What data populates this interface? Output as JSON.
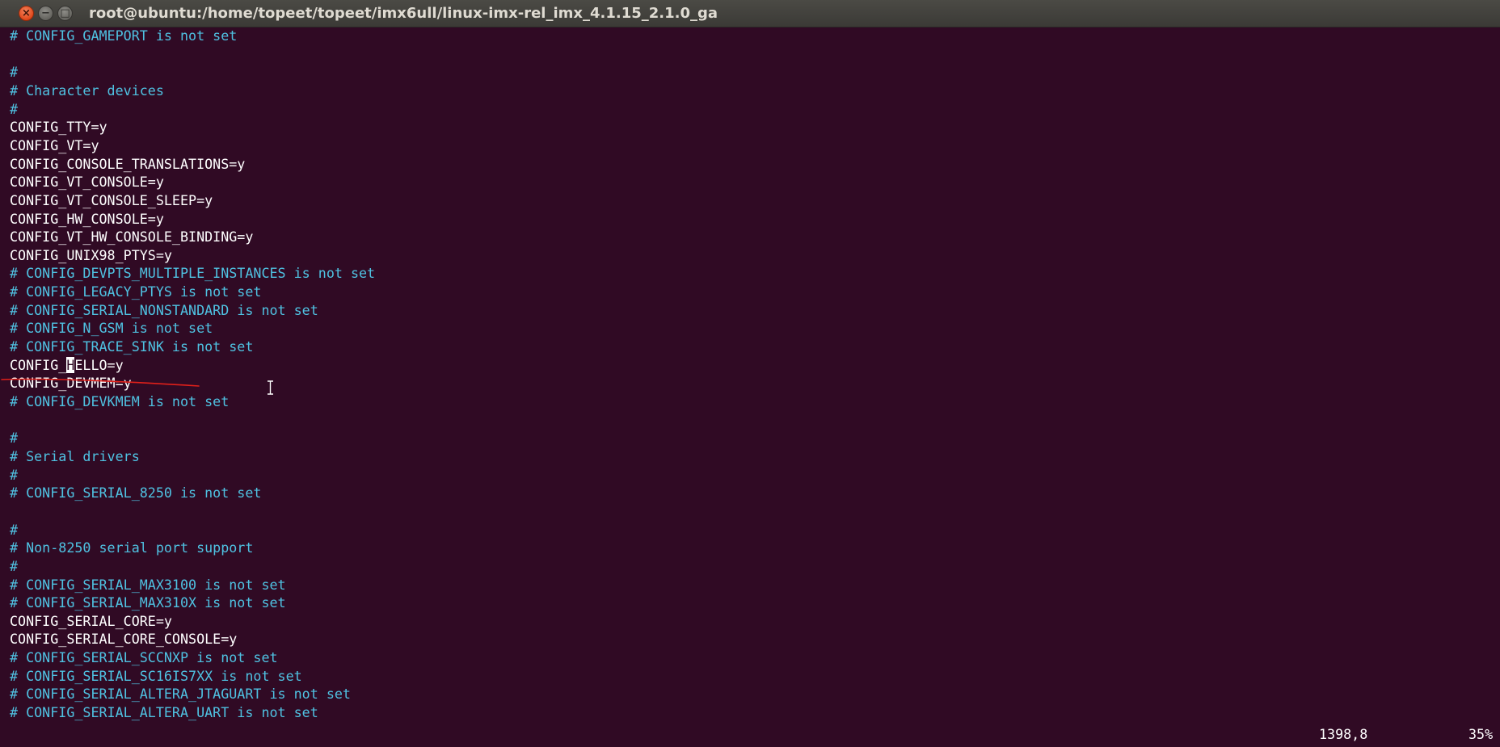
{
  "window": {
    "title": "root@ubuntu:/home/topeet/topeet/imx6ull/linux-imx-rel_imx_4.1.15_2.1.0_ga",
    "buttons": {
      "close": "×",
      "minimize": "−",
      "maximize": "□"
    }
  },
  "editor": {
    "lines": [
      "# CONFIG_GAMEPORT is not set",
      "",
      "#",
      "# Character devices",
      "#",
      "CONFIG_TTY=y",
      "CONFIG_VT=y",
      "CONFIG_CONSOLE_TRANSLATIONS=y",
      "CONFIG_VT_CONSOLE=y",
      "CONFIG_VT_CONSOLE_SLEEP=y",
      "CONFIG_HW_CONSOLE=y",
      "CONFIG_VT_HW_CONSOLE_BINDING=y",
      "CONFIG_UNIX98_PTYS=y",
      "# CONFIG_DEVPTS_MULTIPLE_INSTANCES is not set",
      "# CONFIG_LEGACY_PTYS is not set",
      "# CONFIG_SERIAL_NONSTANDARD is not set",
      "# CONFIG_N_GSM is not set",
      "# CONFIG_TRACE_SINK is not set",
      "CONFIG_HELLO=y",
      "CONFIG_DEVMEM=y",
      "# CONFIG_DEVKMEM is not set",
      "",
      "#",
      "# Serial drivers",
      "#",
      "# CONFIG_SERIAL_8250 is not set",
      "",
      "#",
      "# Non-8250 serial port support",
      "#",
      "# CONFIG_SERIAL_MAX3100 is not set",
      "# CONFIG_SERIAL_MAX310X is not set",
      "CONFIG_SERIAL_CORE=y",
      "CONFIG_SERIAL_CORE_CONSOLE=y",
      "# CONFIG_SERIAL_SCCNXP is not set",
      "# CONFIG_SERIAL_SC16IS7XX is not set",
      "# CONFIG_SERIAL_ALTERA_JTAGUART is not set",
      "# CONFIG_SERIAL_ALTERA_UART is not set"
    ],
    "cursor_line": 18,
    "cursor_col": 7,
    "colors": {
      "background": "#300a24",
      "text": "#ffffff",
      "comment": "#4fc2e2",
      "annotation": "#e0201a"
    }
  },
  "status": {
    "position": "1398,8",
    "percent": "35%"
  }
}
